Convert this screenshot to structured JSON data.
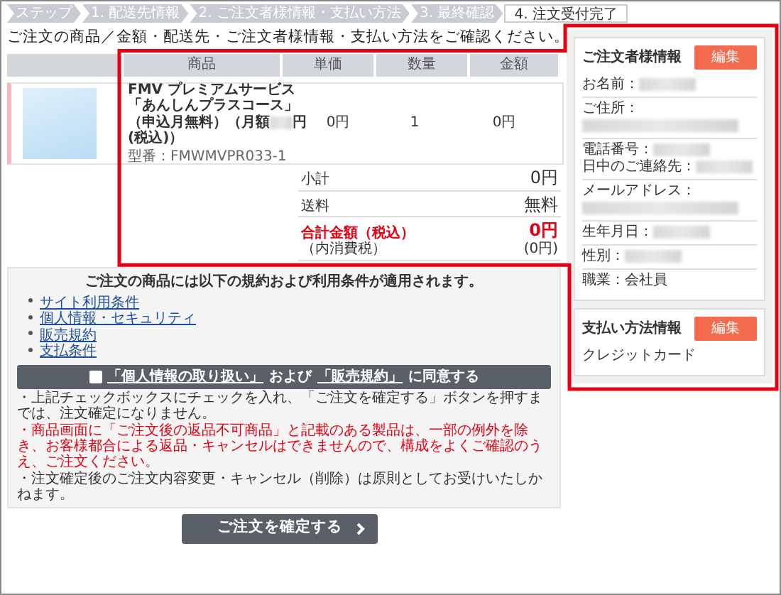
{
  "breadcrumb": [
    {
      "label": "ステップ",
      "selected": false
    },
    {
      "label": "1. 配送先情報",
      "selected": false
    },
    {
      "label": "2. ご注文者様情報・支払い方法",
      "selected": false
    },
    {
      "label": "3. 最終確認",
      "selected": false
    },
    {
      "label": "4. 注文受付完了",
      "selected": true
    }
  ],
  "heading": "ご注文の商品／金額・配送先・ご注文者様情報・支払い方法をご確認ください。",
  "table": {
    "columns": [
      "商品",
      "単価",
      "数量",
      "金額"
    ],
    "rows": [
      {
        "name": "FMV プレミアムサービス「あんしんプラスコース」（申込月無料）（月額",
        "name_after_redaction": "円(税込)）",
        "model": "型番：FMWMVPR033-1",
        "unit_price": "0円",
        "quantity": "1",
        "amount": "0円"
      }
    ]
  },
  "totals": [
    {
      "kind": "normal",
      "label": "小計",
      "value": "0円"
    },
    {
      "kind": "normal",
      "label": "送料",
      "value": "無料"
    },
    {
      "kind": "total",
      "label": "合計金額（税込）",
      "value": "0円",
      "sub_label": "（内消費税）",
      "sub_value": "(0円)"
    }
  ],
  "terms": {
    "title": "ご注文の商品には以下の規約および利用条件が適用されます。",
    "links": [
      "サイト利用条件",
      "個人情報・セキュリティ",
      "販売規約",
      "支払条件"
    ],
    "agree": {
      "checked": false,
      "parts": [
        {
          "kind": "link",
          "text": "「個人情報の取り扱い」"
        },
        {
          "kind": "text",
          "text": "および"
        },
        {
          "kind": "link",
          "text": "「販売規約」"
        },
        {
          "kind": "text",
          "text": "に同意する"
        }
      ]
    },
    "notes": [
      {
        "kind": "small",
        "text": "・上記チェックボックスにチェックを入れ、「ご注文を確定する」ボタンを押すまでは、注文確定になりません。"
      },
      {
        "kind": "warning",
        "text": "・商品画面に「ご注文後の返品不可商品」と記載のある製品は、一部の例外を除き、お客様都合による返品・キャンセルはできませんので、構成をよくご確認のうえ、ご注文ください。"
      },
      {
        "kind": "small",
        "text": "・注文確定後のご注文内容変更・キャンセル（削除）は原則としてお受けいたしかねます。"
      }
    ]
  },
  "confirm_button": "ご注文を確定する",
  "sidebar": [
    {
      "title": "ご注文者様情報",
      "edit": "編集",
      "sections": [
        [
          {
            "kind": "inline-redacted",
            "label": "お名前："
          }
        ],
        [
          {
            "kind": "below-redacted",
            "label": "ご住所："
          }
        ],
        [
          {
            "kind": "inline-redacted",
            "label": "電話番号："
          },
          {
            "kind": "inline-redacted",
            "label": "日中のご連絡先："
          }
        ],
        [
          {
            "kind": "below-redacted",
            "label": "メールアドレス："
          }
        ],
        [
          {
            "kind": "inline-redacted",
            "label": "生年月日："
          }
        ],
        [
          {
            "kind": "inline-redacted",
            "label": "性別："
          }
        ],
        [
          {
            "kind": "text",
            "label": "職業：",
            "value": "会社員"
          }
        ]
      ]
    },
    {
      "title": "支払い方法情報",
      "edit": "編集",
      "sections": [
        [
          {
            "kind": "plain",
            "value": "クレジットカード"
          }
        ]
      ]
    }
  ]
}
